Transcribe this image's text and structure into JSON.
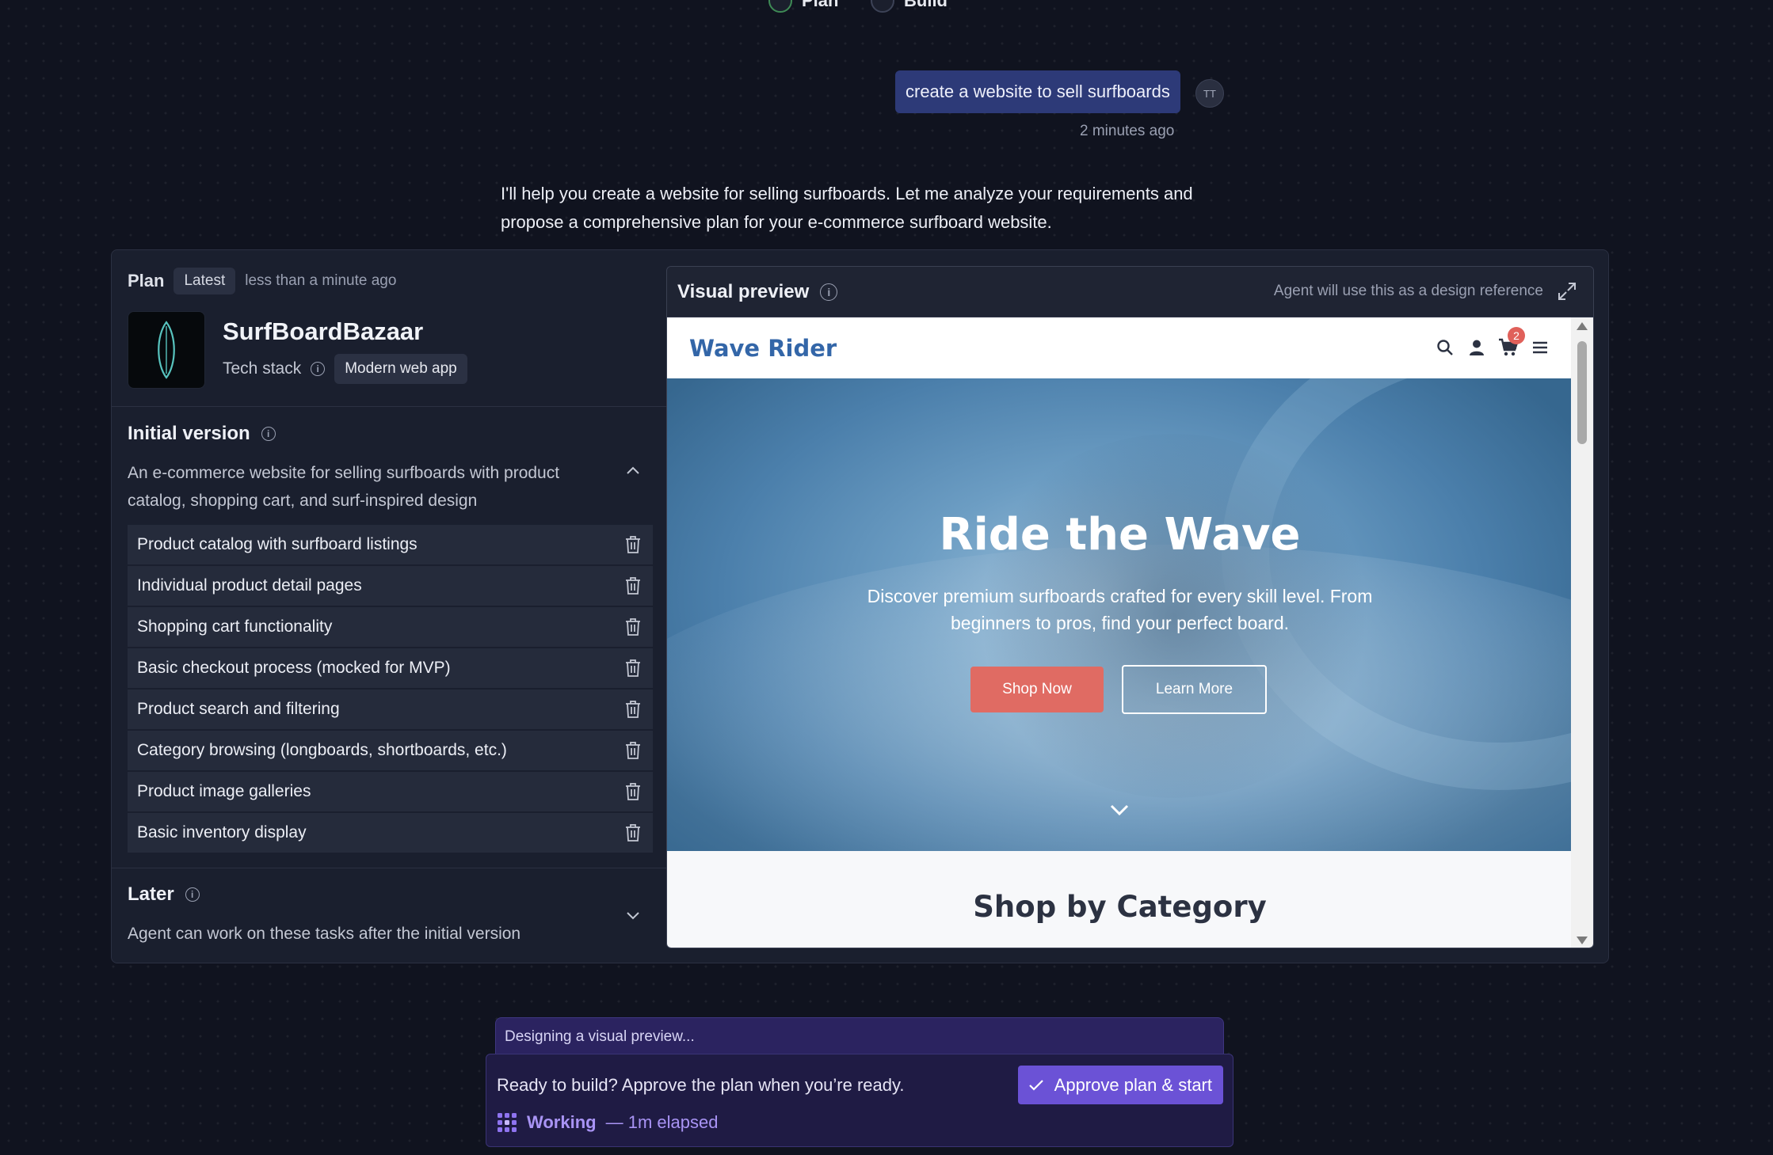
{
  "top_tabs": [
    {
      "label": "Plan",
      "active": true
    },
    {
      "label": "Build",
      "active": false
    }
  ],
  "chat": {
    "user_message": "create a website to sell surfboards",
    "user_avatar": "TT",
    "message_time": "2 minutes ago",
    "assistant_message": "I'll help you create a website for selling surfboards. Let me analyze your requirements and propose a comprehensive plan for your e-commerce surfboard website."
  },
  "plan": {
    "label": "Plan",
    "badge": "Latest",
    "time": "less than a minute ago",
    "app_name": "SurfBoardBazaar",
    "tech_stack_label": "Tech stack",
    "tech_stack_value": "Modern web app",
    "initial_version": {
      "title": "Initial version",
      "description": "An e-commerce website for selling surfboards with product catalog, shopping cart, and surf-inspired design",
      "features": [
        "Product catalog with surfboard listings",
        "Individual product detail pages",
        "Shopping cart functionality",
        "Basic checkout process (mocked for MVP)",
        "Product search and filtering",
        "Category browsing (longboards, shortboards, etc.)",
        "Product image galleries",
        "Basic inventory display"
      ]
    },
    "later": {
      "title": "Later",
      "description": "Agent can work on these tasks after the initial version"
    }
  },
  "visual_preview": {
    "title": "Visual preview",
    "note": "Agent will use this as a design reference",
    "site": {
      "logo": "Wave Rider",
      "cart_count": "2",
      "hero_title": "Ride the Wave",
      "hero_subtitle": "Discover premium surfboards crafted for every skill level. From beginners to pros, find your perfect board.",
      "shop_button": "Shop Now",
      "learn_button": "Learn More",
      "section_title": "Shop by Category"
    }
  },
  "status": {
    "designing": "Designing a visual preview...",
    "ready_text": "Ready to build? Approve the plan when you’re ready.",
    "approve_button": "Approve plan & start",
    "working_label": "Working",
    "working_elapsed": "— 1m elapsed"
  },
  "colors": {
    "background": "#10131f",
    "user_bubble": "#2d3a78",
    "approve": "#6b52d6",
    "brand_blue": "#3366a8",
    "shop_button": "#e06b63"
  }
}
